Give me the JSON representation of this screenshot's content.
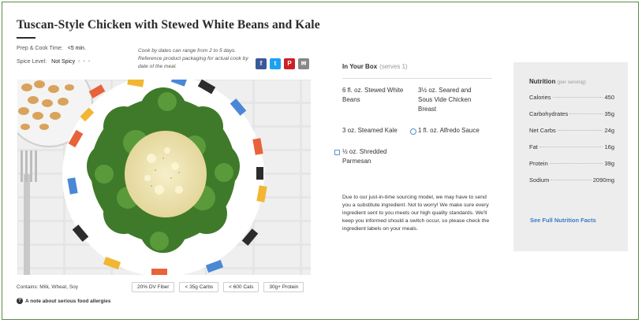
{
  "recipe": {
    "title": "Tuscan-Style Chicken with Stewed White Beans and Kale",
    "prep_label": "Prep & Cook Time:",
    "prep_value": "<5 min.",
    "spice_label": "Spice Level:",
    "spice_value": "Not Spicy",
    "spice_dots": "• • •",
    "cook_note": "Cook by dates can range from 2 to 5 days. Reference product packaging for actual cook by date of the meal."
  },
  "share": [
    {
      "label": "f",
      "icon": "facebook-icon",
      "color": "#3b5998"
    },
    {
      "label": "t",
      "icon": "twitter-icon",
      "color": "#1da1f2"
    },
    {
      "label": "P",
      "icon": "pinterest-icon",
      "color": "#cb2027"
    },
    {
      "label": "✉",
      "icon": "email-icon",
      "color": "#888888"
    }
  ],
  "footer": {
    "contains": "Contains: Milk, Wheat, Soy",
    "tags": [
      "20% DV Fiber",
      "< 35g Carbs",
      "< 600 Cals",
      "30g+ Protein"
    ],
    "allergy_note": "A note about serious food allergies"
  },
  "box": {
    "title": "In Your Box",
    "serves": "(serves 1)",
    "ingredients": [
      "6 fl. oz. Stewed White Beans",
      "3½ oz. Seared and Sous Vide Chicken Breast",
      "3 oz. Steamed Kale",
      "1 fl. oz. Alfredo Sauce",
      "½ oz. Shredded Parmesan"
    ],
    "sourcing": "Due to our just-in-time sourcing model, we may have to send you a substitute ingredient. Not to worry! We make sure every ingredient sent to you meets our high quality standards. We'll keep you informed should a switch occur, so please check the ingredient labels on your meals."
  },
  "nutrition": {
    "title": "Nutrition",
    "subtitle": "(per serving)",
    "rows": [
      {
        "label": "Calories",
        "value": "450"
      },
      {
        "label": "Carbohydrates",
        "value": "35g"
      },
      {
        "label": "Net Carbs",
        "value": "24g"
      },
      {
        "label": "Fat",
        "value": "16g"
      },
      {
        "label": "Protein",
        "value": "39g"
      },
      {
        "label": "Sodium",
        "value": "2090mg"
      }
    ],
    "link": "See Full Nutrition Facts"
  }
}
